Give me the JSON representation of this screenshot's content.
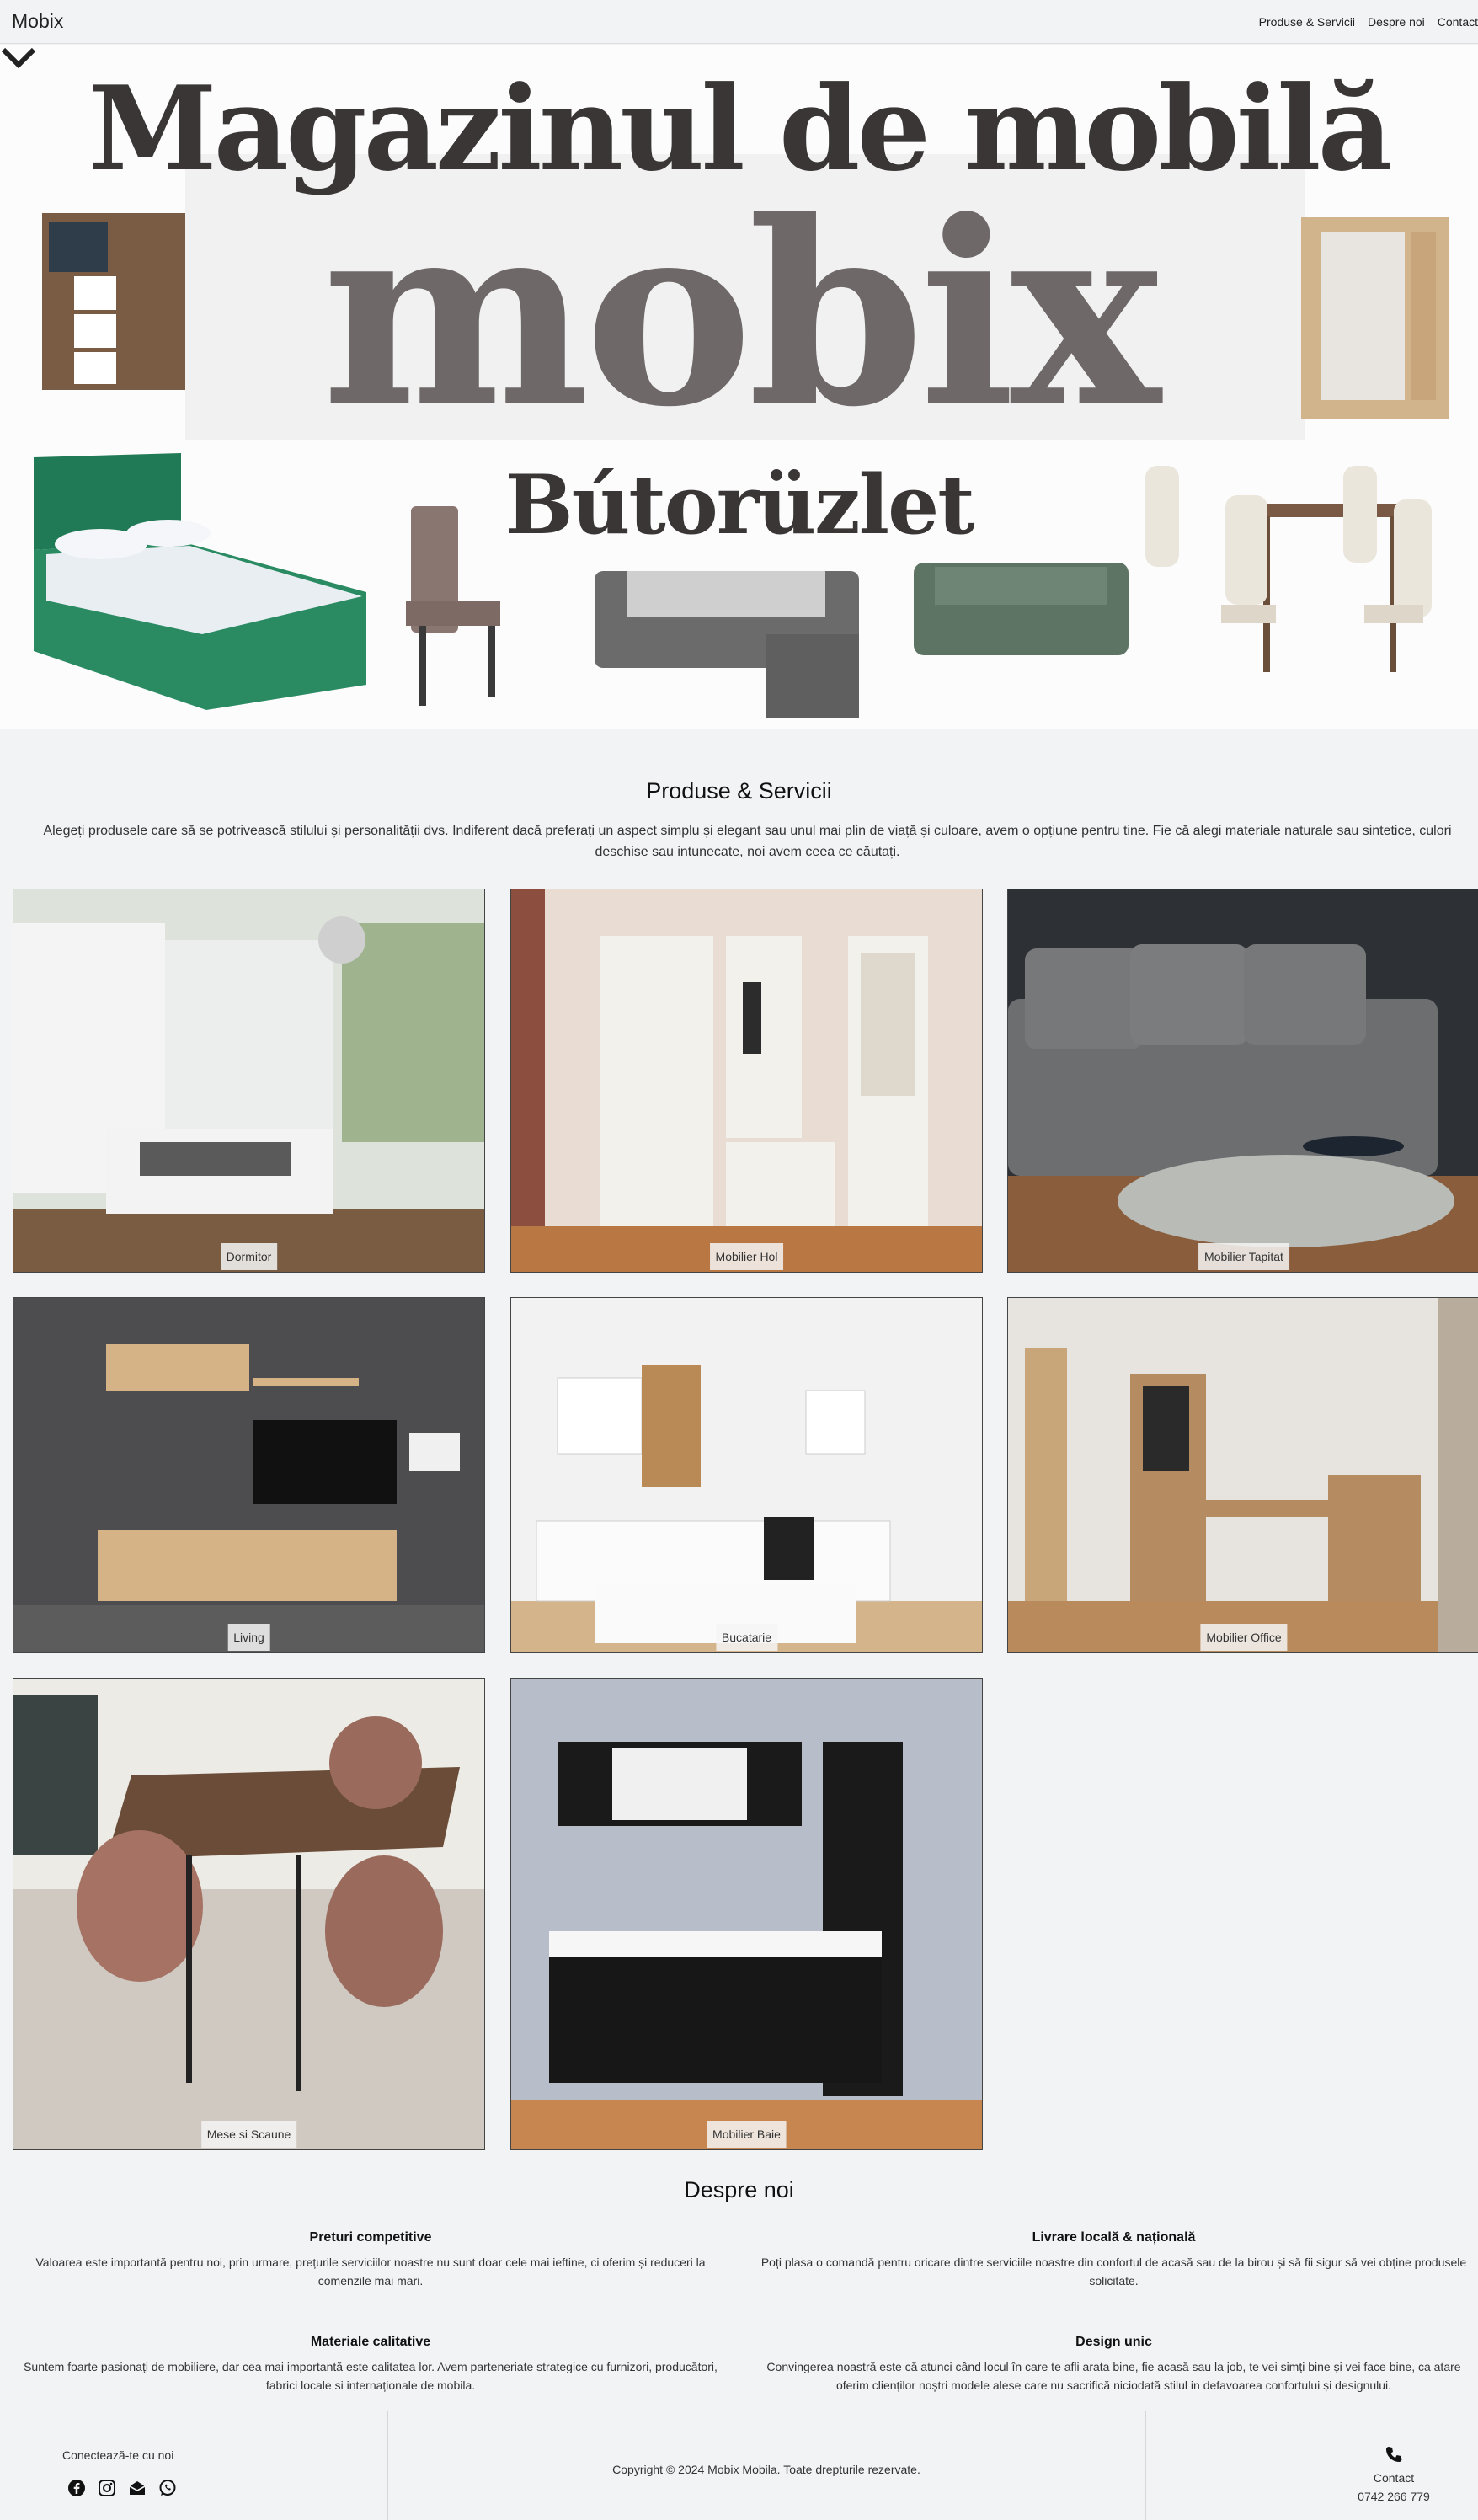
{
  "navbar": {
    "brand": "Mobix",
    "links": [
      "Produse & Servicii",
      "Despre noi",
      "Contact"
    ]
  },
  "hero": {
    "title_line1": "Magazinul de mobilă",
    "title_line2": "mobix",
    "title_line3": "Bútorüzlet"
  },
  "products": {
    "title": "Produse & Servicii",
    "description": "Alegeți produsele care să se potrivească stilului și personalității dvs. Indiferent dacă preferați un aspect simplu și elegant sau unul mai plin de viață și culoare, avem o opțiune pentru tine. Fie că alegi materiale naturale sau sintetice, culori deschise sau intunecate, noi avem ceea ce căutați.",
    "items": [
      {
        "label": "Dormitor"
      },
      {
        "label": "Mobilier Hol"
      },
      {
        "label": "Mobilier Tapitat"
      },
      {
        "label": "Living"
      },
      {
        "label": "Bucatarie"
      },
      {
        "label": "Mobilier Office"
      },
      {
        "label": "Mese si Scaune"
      },
      {
        "label": "Mobilier Baie"
      }
    ]
  },
  "about": {
    "title": "Despre noi",
    "features": [
      {
        "title": "Preturi competitive",
        "text": "Valoarea este importantă pentru noi, prin urmare, prețurile serviciilor noastre nu sunt doar cele mai ieftine, ci oferim și reduceri la comenzile mai mari."
      },
      {
        "title": "Livrare locală & națională",
        "text": "Poți plasa o comandă pentru oricare dintre serviciile noastre din confortul de acasă sau de la birou și să fii sigur să vei obține produsele solicitate."
      },
      {
        "title": "Materiale calitative",
        "text": "Suntem foarte pasionați de mobiliere, dar cea mai importantă este calitatea lor. Avem parteneriate strategice cu furnizori, producători, fabrici locale si internaționale de mobila."
      },
      {
        "title": "Design unic",
        "text": "Convingerea noastră este că atunci când locul în care te afli arata bine, fie acasă sau la job, te vei simți bine și vei face bine, ca atare oferim clienților noștri modele alese care nu sacrifică niciodată stilul in defavoarea confortului și designului."
      }
    ]
  },
  "footer": {
    "connect_label": "Conectează-te cu noi",
    "social_icons": [
      "facebook-icon",
      "instagram-icon",
      "email-icon",
      "whatsapp-icon"
    ],
    "copyright": "Copyright © 2024 Mobix Mobila. Toate drepturile rezervate.",
    "contact_label": "Contact",
    "contact_phone": "0742 266 779"
  }
}
